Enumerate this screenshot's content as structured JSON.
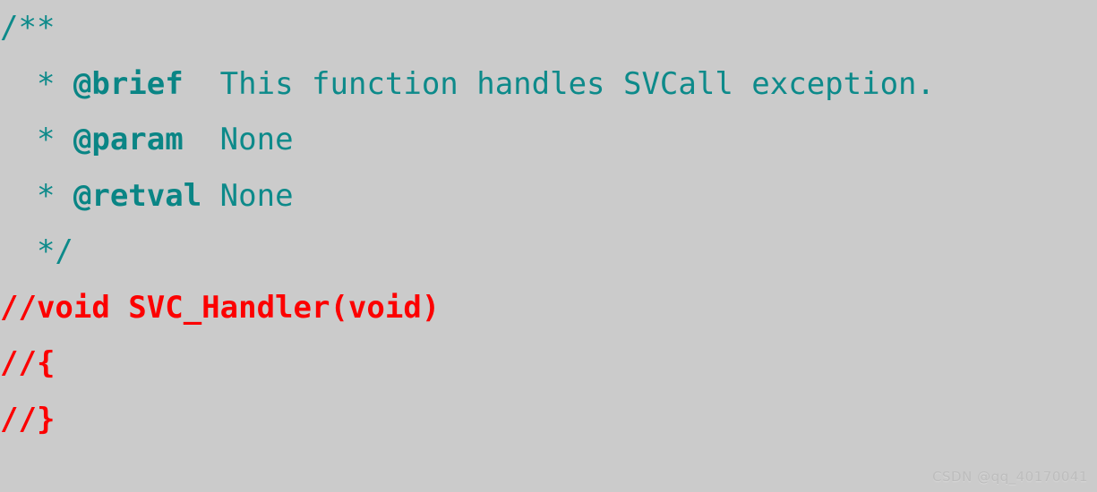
{
  "editor": {
    "background_color": "#cbcbcb",
    "font_size_px": 34,
    "line_height_px": 62.5,
    "comment_color": "#0d8a8a",
    "doctag_color": "#0a8585",
    "commented_code_color": "#fc0000"
  },
  "code": {
    "lines": [
      {
        "index": 1,
        "type": "comment",
        "segments": [
          {
            "kind": "comment",
            "text": "/**"
          }
        ]
      },
      {
        "index": 2,
        "type": "comment",
        "segments": [
          {
            "kind": "comment",
            "text": "  * "
          },
          {
            "kind": "doctag",
            "text": "@brief"
          },
          {
            "kind": "comment",
            "text": "  This function handles SVCall exception."
          }
        ]
      },
      {
        "index": 3,
        "type": "comment",
        "segments": [
          {
            "kind": "comment",
            "text": "  * "
          },
          {
            "kind": "doctag",
            "text": "@param"
          },
          {
            "kind": "comment",
            "text": "  None"
          }
        ]
      },
      {
        "index": 4,
        "type": "comment",
        "segments": [
          {
            "kind": "comment",
            "text": "  * "
          },
          {
            "kind": "doctag",
            "text": "@retval"
          },
          {
            "kind": "comment",
            "text": " None"
          }
        ]
      },
      {
        "index": 5,
        "type": "comment",
        "segments": [
          {
            "kind": "comment",
            "text": "  */"
          }
        ]
      },
      {
        "index": 6,
        "type": "commented-code",
        "segments": [
          {
            "kind": "commented-code",
            "text": "//void SVC_Handler(void)"
          }
        ]
      },
      {
        "index": 7,
        "type": "commented-code",
        "segments": [
          {
            "kind": "commented-code",
            "text": "//{"
          }
        ]
      },
      {
        "index": 8,
        "type": "commented-code",
        "segments": [
          {
            "kind": "commented-code",
            "text": "//}"
          }
        ]
      }
    ]
  },
  "watermark": {
    "text": "CSDN @qq_40170041"
  }
}
